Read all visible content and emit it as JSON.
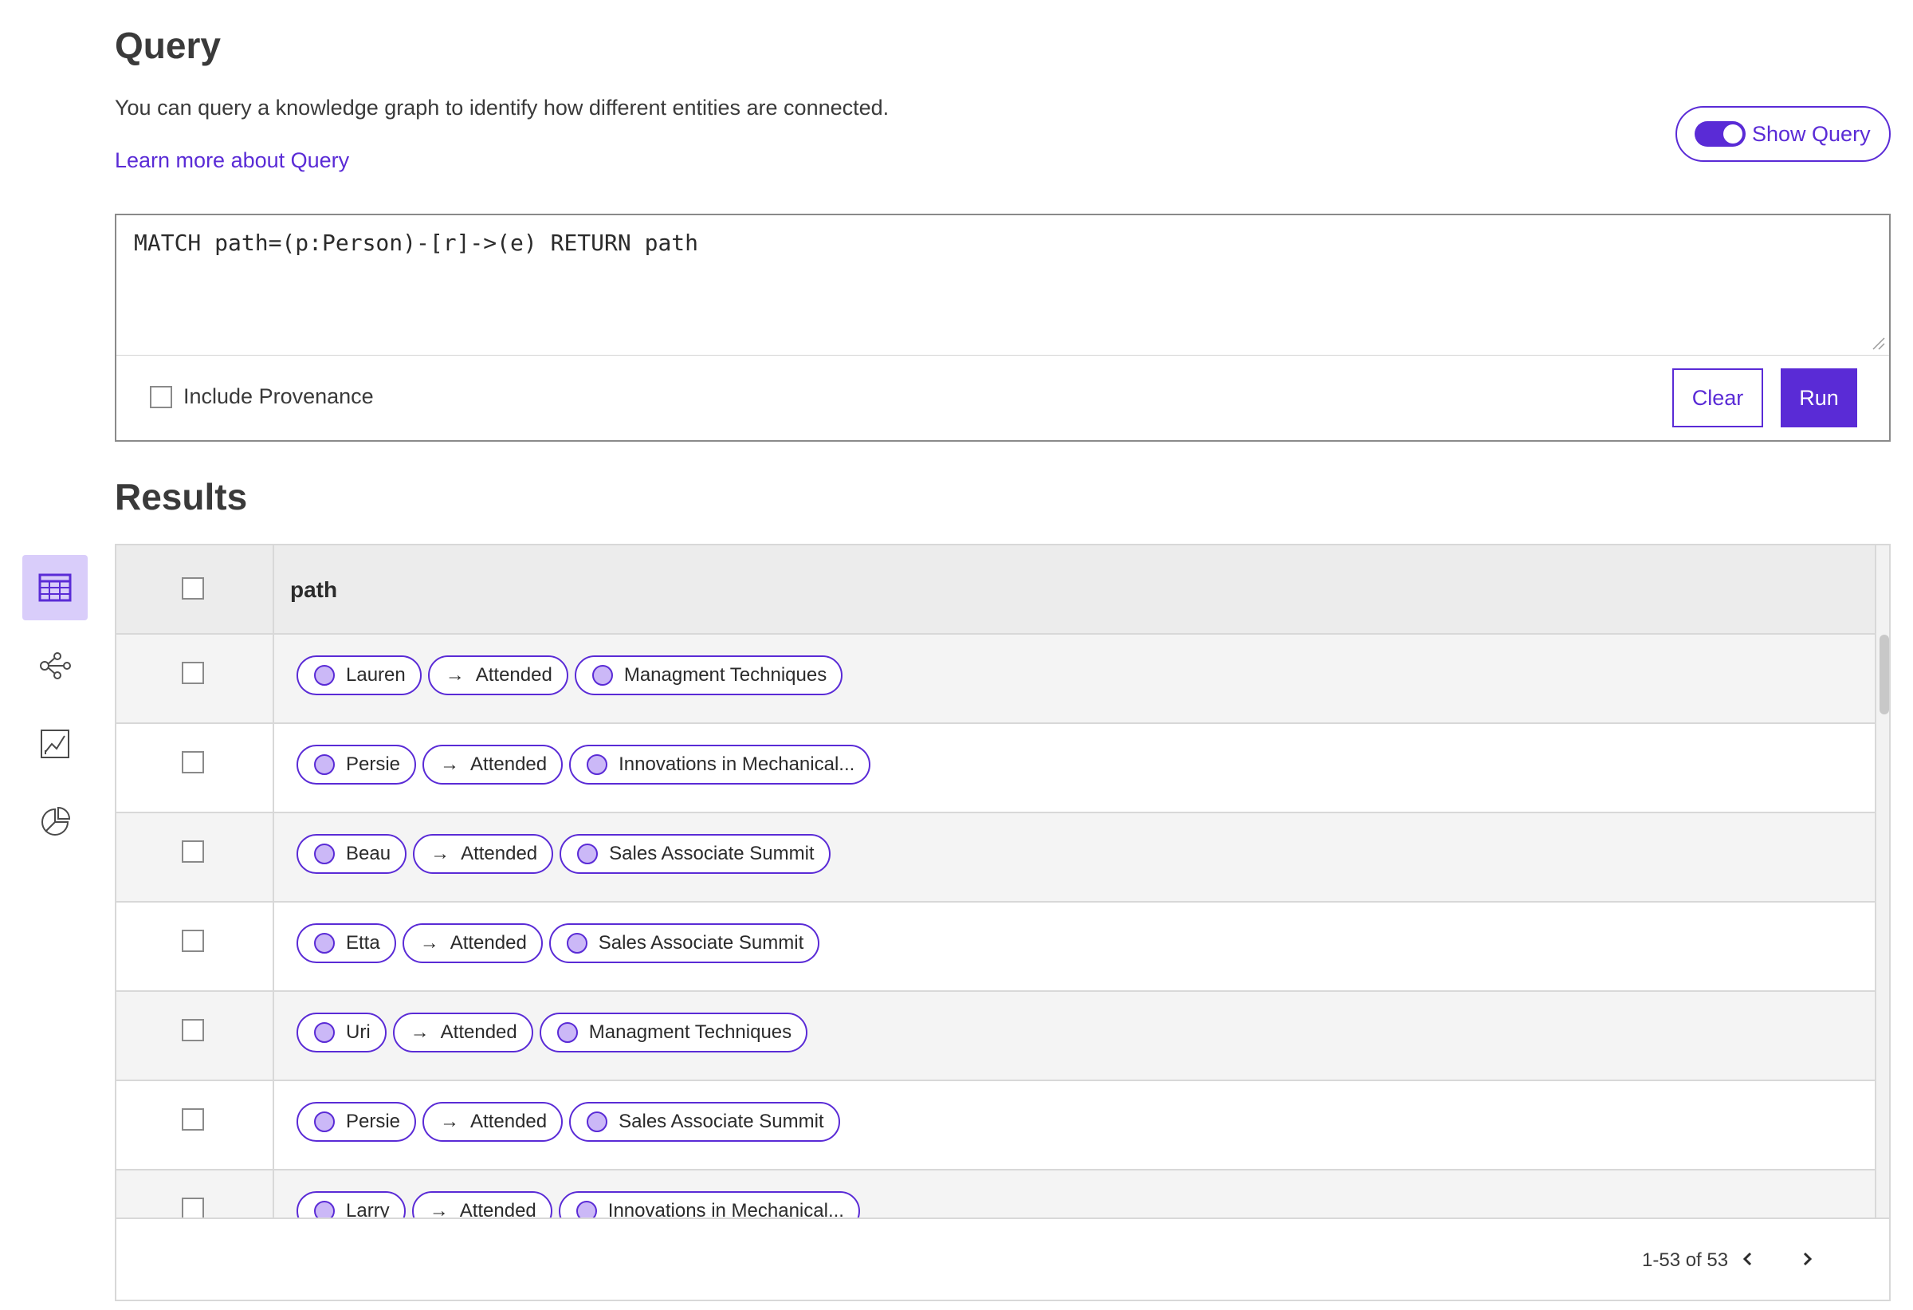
{
  "header": {
    "title": "Query",
    "description": "You can query a knowledge graph to identify how different entities are connected.",
    "learn_more": "Learn more about Query",
    "show_query_label": "Show Query"
  },
  "query": {
    "text": "MATCH path=(p:Person)-[r]->(e) RETURN path",
    "include_provenance_label": "Include Provenance",
    "clear_label": "Clear",
    "run_label": "Run"
  },
  "results": {
    "title": "Results",
    "column_header": "path",
    "rows": [
      {
        "person": "Lauren",
        "relation": "Attended",
        "event": "Managment Techniques"
      },
      {
        "person": "Persie",
        "relation": "Attended",
        "event": "Innovations in Mechanical..."
      },
      {
        "person": "Beau",
        "relation": "Attended",
        "event": "Sales Associate Summit"
      },
      {
        "person": "Etta",
        "relation": "Attended",
        "event": "Sales Associate Summit"
      },
      {
        "person": "Uri",
        "relation": "Attended",
        "event": "Managment Techniques"
      },
      {
        "person": "Persie",
        "relation": "Attended",
        "event": "Sales Associate Summit"
      },
      {
        "person": "Larry",
        "relation": "Attended",
        "event": "Innovations in Mechanical..."
      }
    ],
    "pagination": "1-53 of 53"
  },
  "view_switcher": {
    "items": [
      {
        "icon": "table-icon",
        "active": true
      },
      {
        "icon": "graph-icon",
        "active": false
      },
      {
        "icon": "line-chart-icon",
        "active": false
      },
      {
        "icon": "pie-chart-icon",
        "active": false
      }
    ]
  },
  "colors": {
    "accent": "#5a2bd6",
    "accent_light": "#d9cdfa",
    "node_fill": "#cbb8f7"
  }
}
